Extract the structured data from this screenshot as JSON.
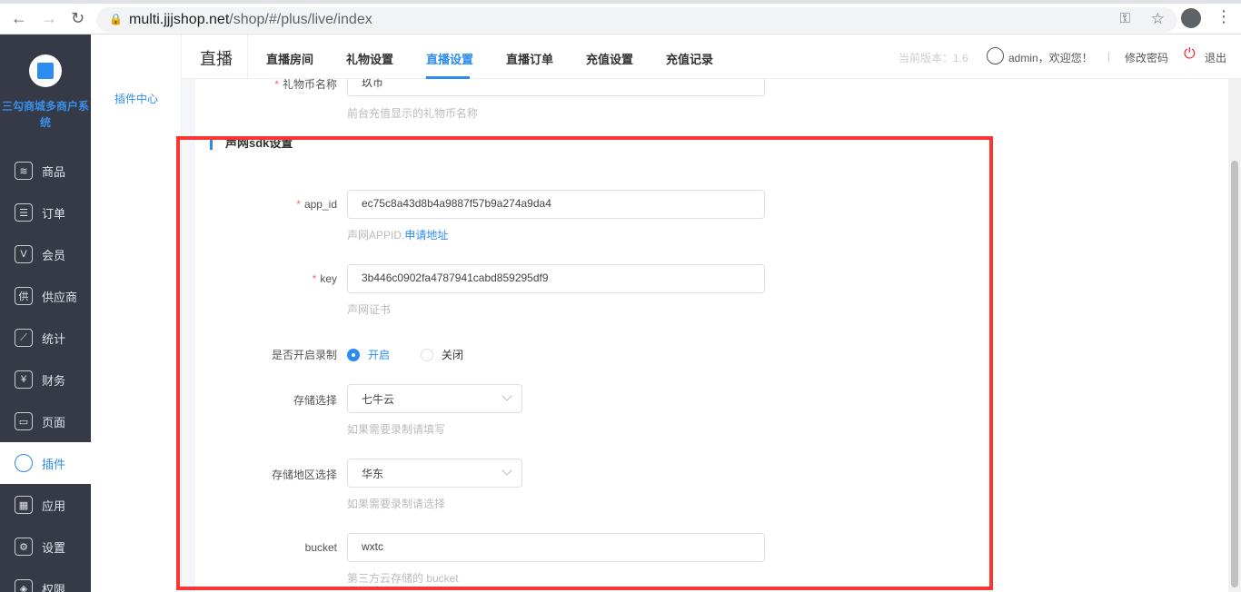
{
  "browser": {
    "url_host": "multi.jjjshop.net",
    "url_path": "/shop/#/plus/live/index"
  },
  "sidebar": {
    "brand": "三勾商城多商户系统",
    "items": [
      {
        "label": "商品",
        "icon": "layers-icon"
      },
      {
        "label": "订单",
        "icon": "clipboard-icon"
      },
      {
        "label": "会员",
        "icon": "vip-icon"
      },
      {
        "label": "供应商",
        "icon": "supplier-icon"
      },
      {
        "label": "统计",
        "icon": "chart-icon"
      },
      {
        "label": "财务",
        "icon": "finance-icon"
      },
      {
        "label": "页面",
        "icon": "page-icon"
      },
      {
        "label": "插件",
        "icon": "plugin-icon",
        "active": true
      },
      {
        "label": "应用",
        "icon": "apps-icon"
      },
      {
        "label": "设置",
        "icon": "gear-icon"
      },
      {
        "label": "权限",
        "icon": "shield-icon"
      }
    ]
  },
  "subnav": {
    "item": "插件中心"
  },
  "header": {
    "title": "直播",
    "tabs": [
      "直播房间",
      "礼物设置",
      "直播设置",
      "直播订单",
      "充值设置",
      "充值记录"
    ],
    "active_tab": "直播设置",
    "version": "当前版本：1.6",
    "user": "admin，欢迎您！",
    "divider": "|",
    "change_password": "修改密码",
    "logout": "退出"
  },
  "form": {
    "gift_name": {
      "label": "礼物币名称",
      "value": "玖币",
      "hint": "前台充值显示的礼物币名称"
    },
    "section": "声网sdk设置",
    "app_id": {
      "label": "app_id",
      "value": "ec75c8a43d8b4a9887f57b9a274a9da4",
      "hint": "声网APPID,",
      "hint_link": "申请地址"
    },
    "key": {
      "label": "key",
      "value": "3b446c0902fa4787941cabd859295df9",
      "hint": "声网证书"
    },
    "record": {
      "label": "是否开启录制",
      "options": [
        "开启",
        "关闭"
      ],
      "selected": "开启"
    },
    "storage": {
      "label": "存储选择",
      "value": "七牛云",
      "hint": "如果需要录制请填写"
    },
    "region": {
      "label": "存储地区选择",
      "value": "华东",
      "hint": "如果需要录制请选择"
    },
    "bucket": {
      "label": "bucket",
      "value": "wxtc",
      "hint": "第三方云存储的 bucket"
    }
  },
  "colors": {
    "accent": "#2d8cf0",
    "sidebar": "#363a47",
    "highlight": "#fb3434"
  }
}
